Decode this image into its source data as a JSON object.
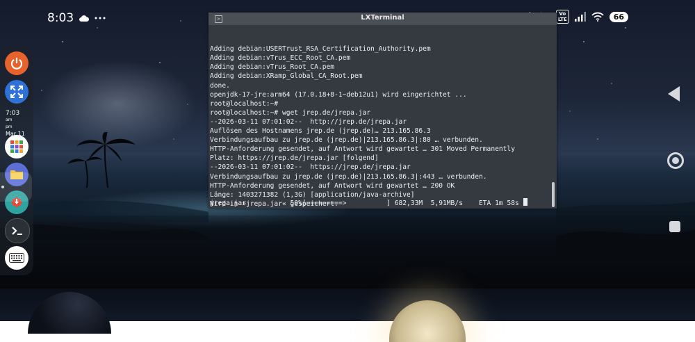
{
  "status_bar": {
    "time": "8:03",
    "battery": "66",
    "network_badge": "Vo\nLTE",
    "icons": [
      "cloud-icon",
      "more-icon",
      "bluetooth-icon",
      "mute-icon",
      "signal-icon",
      "wifi-icon"
    ]
  },
  "dock": {
    "clock_time": "7:03",
    "clock_ampm": "am\npm",
    "clock_date": "Mar 11",
    "items": [
      {
        "name": "power-icon",
        "color": "#e8622c"
      },
      {
        "name": "fullscreen-icon",
        "color": "#2e71d8"
      },
      {
        "name": "apps-grid-icon",
        "color": "#ffffff"
      },
      {
        "name": "folder-icon",
        "color": "#5b6fd6"
      },
      {
        "name": "installer-icon",
        "color": "#2ea3a0"
      },
      {
        "name": "terminal-icon",
        "color": "#2b2f36"
      },
      {
        "name": "keyboard-icon",
        "color": "#ffffff"
      }
    ]
  },
  "terminal": {
    "title": "LXTerminal",
    "lines": [
      "Adding debian:USERTrust_RSA_Certification_Authority.pem",
      "Adding debian:vTrus_ECC_Root_CA.pem",
      "Adding debian:vTrus_Root_CA.pem",
      "Adding debian:XRamp_Global_CA_Root.pem",
      "done.",
      "openjdk-17-jre:arm64 (17.0.18+8-1~deb12u1) wird eingerichtet ...",
      "root@localhost:~#",
      "root@localhost:~# wget jrep.de/jrepa.jar",
      "--2026-03-11 07:01:02--  http://jrep.de/jrepa.jar",
      "Auflösen des Hostnamens jrep.de (jrep.de)… 213.165.86.3",
      "Verbindungsaufbau zu jrep.de (jrep.de)|213.165.86.3|:80 … verbunden.",
      "HTTP-Anforderung gesendet, auf Antwort wird gewartet … 301 Moved Permanently",
      "Platz: https://jrep.de/jrepa.jar [folgend]",
      "--2026-03-11 07:01:02--  https://jrep.de/jrepa.jar",
      "Verbindungsaufbau zu jrep.de (jrep.de)|213.165.86.3|:443 … verbunden.",
      "HTTP-Anforderung gesendet, auf Antwort wird gewartet … 200 OK",
      "Länge: 1403271382 (1,3G) [application/java-archive]",
      "Wird in »jrepa.jar« gespeichert.",
      ""
    ],
    "progress_line": "jrepa.jar           50%[=========>          ] 682,33M  5,91MB/s    ETA 1m 58s "
  },
  "nav": {
    "icons": [
      "back-icon",
      "home-icon",
      "recent-apps-icon"
    ]
  }
}
